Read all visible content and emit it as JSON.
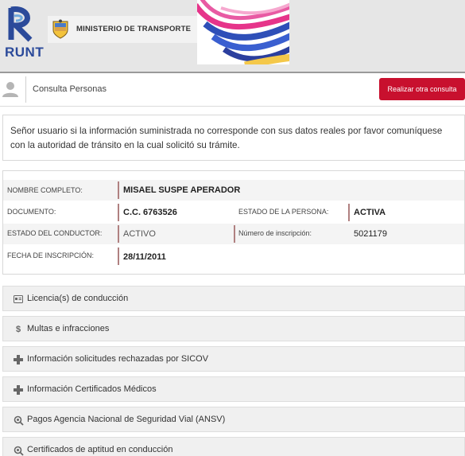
{
  "brand": {
    "logo_text": "RUNT",
    "ministry": "MINISTERIO DE TRANSPORTE"
  },
  "toolbar": {
    "title": "Consulta Personas",
    "button": "Realizar otra consulta"
  },
  "notice": "Señor usuario si la información suministrada no corresponde con sus datos reales por favor comuníquese con la autoridad de tránsito en la cual solicitó su trámite.",
  "person": {
    "nombre_label": "NOMBRE COMPLETO:",
    "nombre": "MISAEL SUSPE APERADOR",
    "documento_label": "DOCUMENTO:",
    "documento": "C.C. 6763526",
    "estado_persona_label": "ESTADO DE LA PERSONA:",
    "estado_persona": "ACTIVA",
    "estado_conductor_label": "ESTADO DEL CONDUCTOR:",
    "estado_conductor": "ACTIVO",
    "num_inscripcion_label": "Número de inscripción:",
    "num_inscripcion": "5021179",
    "fecha_label": "FECHA DE INSCRIPCIÓN:",
    "fecha": "28/11/2011"
  },
  "sections": [
    {
      "label": "Licencia(s) de conducción",
      "icon": "id-card-icon"
    },
    {
      "label": "Multas e infracciones",
      "icon": "dollar-icon"
    },
    {
      "label": "Información solicitudes rechazadas por SICOV",
      "icon": "medical-cross-icon"
    },
    {
      "label": "Información Certificados Médicos",
      "icon": "medical-cross-icon"
    },
    {
      "label": "Pagos Agencia Nacional de Seguridad Vial (ANSV)",
      "icon": "gear-search-icon"
    },
    {
      "label": "Certificados de aptitud en conducción",
      "icon": "gear-search-icon"
    }
  ],
  "colors": {
    "primary_button": "#c8102e",
    "logo_blue": "#2b4a9a"
  }
}
